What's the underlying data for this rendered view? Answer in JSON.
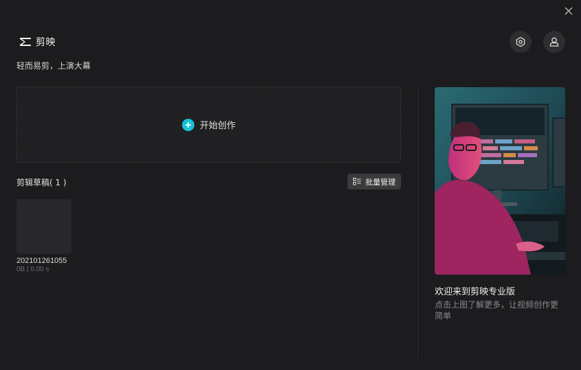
{
  "app": {
    "brand_name": "剪映",
    "tagline": "轻而易剪，上演大幕"
  },
  "create": {
    "label": "开始创作"
  },
  "drafts": {
    "title": "剪辑草稿( 1 )",
    "batch_label": "批量管理",
    "items": [
      {
        "name": "202101261055",
        "meta": "0B | 0.00 s"
      }
    ]
  },
  "promo": {
    "title": "欢迎来到剪映专业版",
    "description": "点击上图了解更多，让视频创作更简单"
  },
  "colors": {
    "background": "#1c1c1e",
    "accent": "#16c2d3",
    "panel": "#202022",
    "button": "#3b3b3e"
  },
  "icons": {
    "close": "close-icon",
    "logo": "capcut-logo-icon",
    "settings": "hexagon-settings-icon",
    "user": "user-icon",
    "plus": "plus-icon",
    "batch": "list-check-icon"
  }
}
